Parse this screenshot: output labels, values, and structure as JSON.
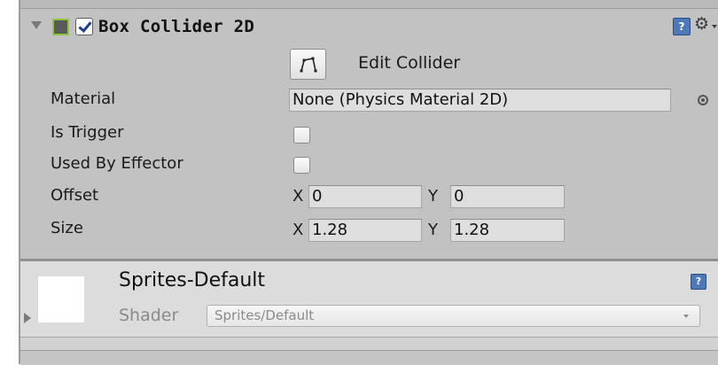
{
  "component": {
    "title": "Box Collider 2D",
    "enabled": true,
    "help_glyph": "?",
    "settings_glyph": "⚙"
  },
  "edit_collider": {
    "label": "Edit Collider"
  },
  "properties": {
    "material": {
      "label": "Material",
      "value": "None (Physics Material 2D)"
    },
    "is_trigger": {
      "label": "Is Trigger",
      "checked": false
    },
    "used_by_effector": {
      "label": "Used By Effector",
      "checked": false
    },
    "offset": {
      "label": "Offset",
      "x_label": "X",
      "x": "0",
      "y_label": "Y",
      "y": "0"
    },
    "size": {
      "label": "Size",
      "x_label": "X",
      "x": "1.28",
      "y_label": "Y",
      "y": "1.28"
    }
  },
  "material_section": {
    "name": "Sprites-Default",
    "shader_label": "Shader",
    "shader_value": "Sprites/Default",
    "help_glyph": "?"
  },
  "colors": {
    "panel_bg": "#c2c2c2",
    "material_bg": "#dcdcdc",
    "component_icon_border": "#8fc63f",
    "checkmark": "#1d3e8a",
    "help_icon": "#4f79b6"
  }
}
